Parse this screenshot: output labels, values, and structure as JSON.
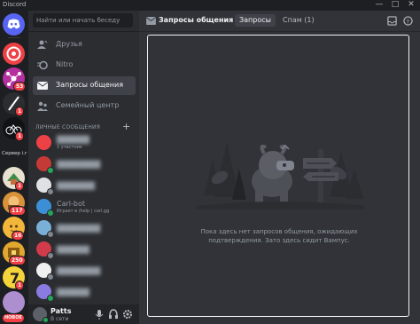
{
  "window": {
    "app_name": "Discord",
    "controls": [
      "—",
      "□",
      "✕"
    ]
  },
  "servers": [
    {
      "icon": "discord-home-icon",
      "color": "#5865f2"
    },
    {
      "icon": "server-avatar",
      "color": "#ed4245"
    },
    {
      "icon": "server-avatar",
      "color": "#b5309f",
      "badge": "53"
    },
    {
      "icon": "server-avatar",
      "color": "#2b2d31",
      "badge": "1"
    },
    {
      "icon": "server-avatar",
      "color": "#111214",
      "badge": "1"
    },
    {
      "icon": "server-folder",
      "label": "Сервер і.г"
    },
    {
      "icon": "server-avatar",
      "color": "#e8e1cf",
      "badge": "1"
    },
    {
      "icon": "server-avatar",
      "color": "#d8923a",
      "badge": "117"
    },
    {
      "icon": "server-avatar",
      "color": "#f2b63a",
      "badge": "16"
    },
    {
      "icon": "server-avatar",
      "color": "#e0a82e",
      "badge": "250"
    },
    {
      "icon": "server-avatar",
      "color": "#f5d33b",
      "badge": "1"
    },
    {
      "icon": "server-avatar",
      "color": "#ad8fcf",
      "badge": "НОВОЕ"
    }
  ],
  "sidebar": {
    "search_placeholder": "Найти или начать беседу",
    "nav": [
      {
        "label": "Друзья",
        "icon": "friends-icon",
        "active": false
      },
      {
        "label": "Nitro",
        "icon": "nitro-icon",
        "active": false
      },
      {
        "label": "Запросы общения",
        "icon": "message-requests-icon",
        "active": true
      },
      {
        "label": "Семейный центр",
        "icon": "family-center-icon",
        "active": false
      }
    ],
    "dm_header": "ЛИЧНЫЕ СООБЩЕНИЯ",
    "dms": [
      {
        "name": "██████",
        "sub": "1 участник",
        "color": "#ed4245",
        "hidden": true
      },
      {
        "name": "████████",
        "sub": "",
        "color": "#c43a37",
        "hidden": true
      },
      {
        "name": "███████",
        "sub": "",
        "color": "#dfe1e5",
        "hidden": true
      },
      {
        "name": "Carl-bot",
        "sub": "Играет в /help | carl.gg",
        "color": "#3c8fd6",
        "hidden": false
      },
      {
        "name": "████████",
        "sub": "",
        "color": "#7ab0d7",
        "hidden": true
      },
      {
        "name": "██████",
        "sub": "",
        "color": "#d13b4a",
        "hidden": true
      },
      {
        "name": "████████",
        "sub": "",
        "color": "#f0f0f0",
        "hidden": true
      },
      {
        "name": "██████",
        "sub": "",
        "color": "#8a7be0",
        "hidden": true
      }
    ],
    "user": {
      "name": "Patts",
      "status": "В сети"
    }
  },
  "main": {
    "title": "Запросы общения",
    "tabs": [
      {
        "label": "Запросы",
        "selected": true
      },
      {
        "label": "Спам (1)",
        "selected": false
      }
    ],
    "empty_text": "Пока здесь нет запросов общения, ожидающих подтверждения. Зато здесь сидит Вампус."
  }
}
